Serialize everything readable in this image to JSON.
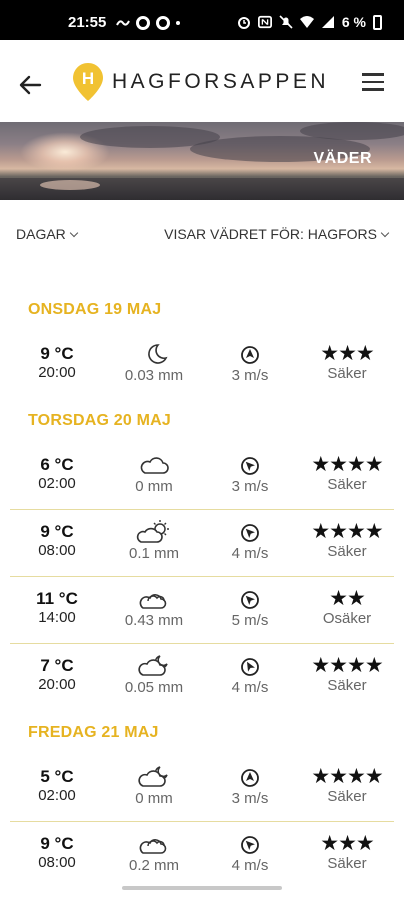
{
  "status_bar": {
    "time": "21:55",
    "battery": "6 %"
  },
  "header": {
    "brand": "HAGFORSAPPEN",
    "logo_letter": "H"
  },
  "banner": {
    "title": "VÄDER"
  },
  "filters": {
    "range": "DAGAR",
    "location": "VISAR VÄDRET FÖR: HAGFORS"
  },
  "days": [
    {
      "label": "ONSDAG 19 MAJ",
      "rows": [
        {
          "temp": "9 °C",
          "time": "20:00",
          "icon": "moon-icon",
          "precip": "0.03 mm",
          "wind": "3 m/s",
          "wind_dir": 90,
          "stars": "★★★",
          "rating": "Säker"
        }
      ]
    },
    {
      "label": "TORSDAG 20 MAJ",
      "rows": [
        {
          "temp": "6 °C",
          "time": "02:00",
          "icon": "cloud-icon",
          "precip": "0 mm",
          "wind": "3 m/s",
          "wind_dir": 45,
          "stars": "★★★★",
          "rating": "Säker"
        },
        {
          "temp": "9 °C",
          "time": "08:00",
          "icon": "partly-cloudy-sun-icon",
          "precip": "0.1 mm",
          "wind": "4 m/s",
          "wind_dir": 45,
          "stars": "★★★★",
          "rating": "Säker"
        },
        {
          "temp": "11 °C",
          "time": "14:00",
          "icon": "clouds-icon",
          "precip": "0.43 mm",
          "wind": "5 m/s",
          "wind_dir": 45,
          "stars": "★★",
          "rating": "Osäker"
        },
        {
          "temp": "7 °C",
          "time": "20:00",
          "icon": "cloud-moon-icon",
          "precip": "0.05 mm",
          "wind": "4 m/s",
          "wind_dir": 60,
          "stars": "★★★★",
          "rating": "Säker"
        }
      ]
    },
    {
      "label": "FREDAG 21 MAJ",
      "rows": [
        {
          "temp": "5 °C",
          "time": "02:00",
          "icon": "cloud-moon-icon",
          "precip": "0 mm",
          "wind": "3 m/s",
          "wind_dir": 90,
          "stars": "★★★★",
          "rating": "Säker"
        },
        {
          "temp": "9 °C",
          "time": "08:00",
          "icon": "clouds-icon",
          "precip": "0.2 mm",
          "wind": "4 m/s",
          "wind_dir": 45,
          "stars": "★★★",
          "rating": "Säker"
        }
      ]
    }
  ],
  "colors": {
    "accent": "#e6b321",
    "divider": "#e6dca0"
  }
}
